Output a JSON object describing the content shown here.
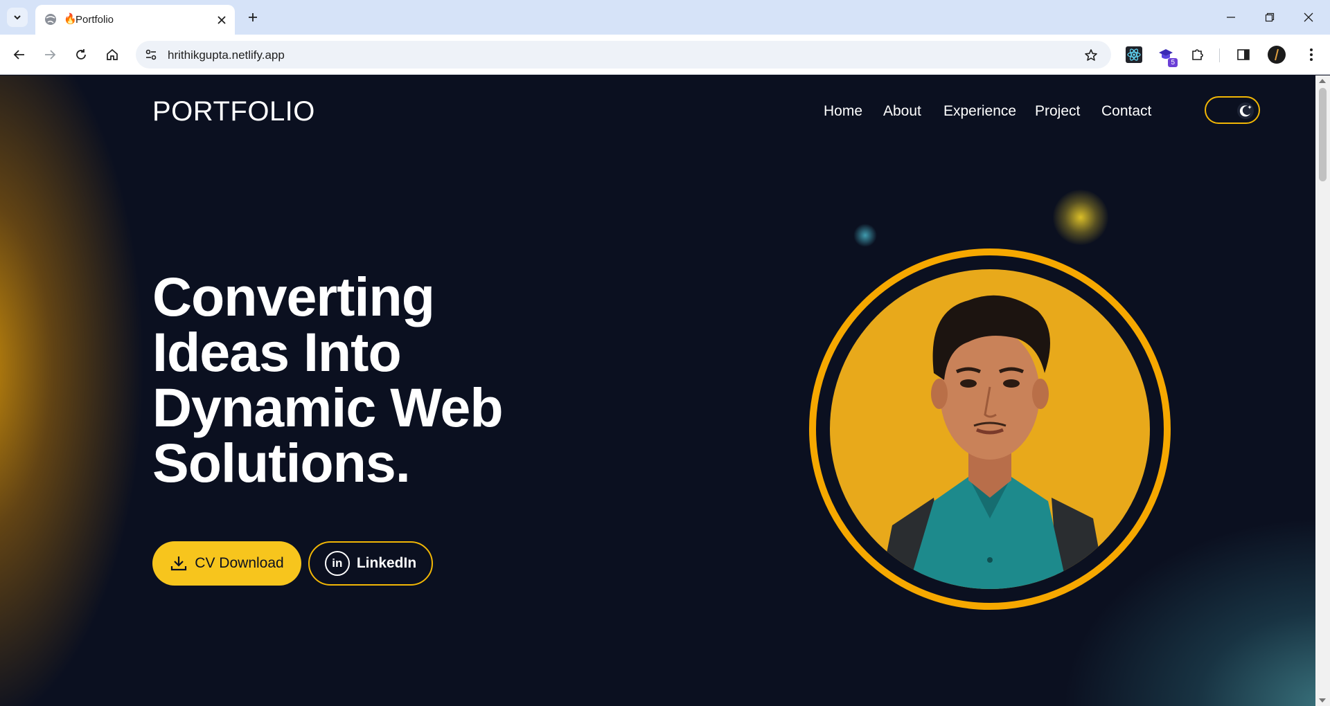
{
  "browser": {
    "tab_title": "Portfolio",
    "tab_favicon": "🔥",
    "url": "hrithikgupta.netlify.app",
    "extension_badge": "5"
  },
  "page": {
    "logo": "PORTFOLIO",
    "nav": [
      "Home",
      "About",
      "Experience",
      "Project",
      "Contact"
    ],
    "headline_lines": [
      "Converting",
      "Ideas Into",
      "Dynamic Web",
      "Solutions."
    ],
    "cv_button": "CV Download",
    "linkedin_button": "LinkedIn",
    "linkedin_icon_text": "in"
  },
  "colors": {
    "accent_yellow": "#f7c51d",
    "ring_orange": "#f6a800",
    "background": "#0b1020"
  }
}
